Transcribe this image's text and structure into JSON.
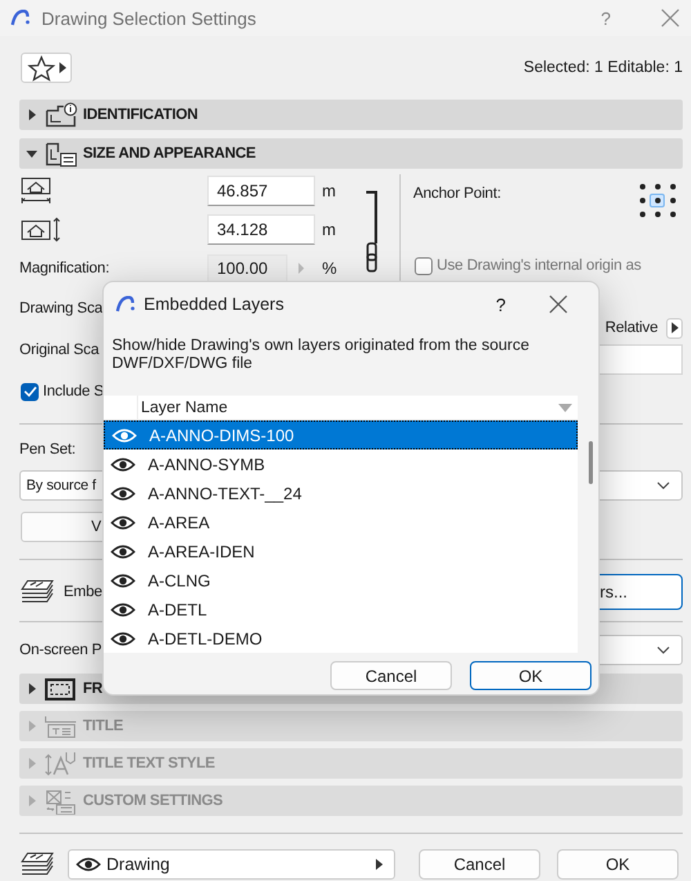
{
  "window": {
    "title": "Drawing Selection Settings",
    "help": "?"
  },
  "selection_info": "Selected: 1 Editable: 1",
  "top_sections": [
    {
      "title": "IDENTIFICATION",
      "expanded": false,
      "disabled": false
    },
    {
      "title": "SIZE AND APPEARANCE",
      "expanded": true,
      "disabled": false
    }
  ],
  "size_and_appearance": {
    "width": {
      "value": "46.857",
      "unit": "m"
    },
    "height": {
      "value": "34.128",
      "unit": "m"
    },
    "magnification": {
      "label": "Magnification:",
      "value": "100.00",
      "unit": "%"
    },
    "drawing_scale": {
      "label": "Drawing Sca"
    },
    "original_scale": {
      "label": "Original Sca"
    },
    "include": {
      "label": "Include S",
      "checked": true
    },
    "anchor": {
      "label": "Anchor Point:",
      "points": [
        {
          "selected": false
        },
        {
          "selected": false
        },
        {
          "selected": false
        },
        {
          "selected": false
        },
        {
          "selected": true
        },
        {
          "selected": false
        },
        {
          "selected": false
        },
        {
          "selected": false
        },
        {
          "selected": false
        }
      ]
    },
    "internal_origin": {
      "label": "Use Drawing's internal origin as",
      "checked": false
    },
    "relative": {
      "label": "Relative"
    },
    "pen_set": {
      "label": "Pen Set:",
      "value": "By source f"
    },
    "button_v": {
      "label": "V"
    },
    "embedded": {
      "label": "Embe",
      "button": "rs..."
    },
    "on_screen": {
      "label": "On-screen P"
    }
  },
  "bottom_sections": [
    {
      "title": "FR",
      "expanded": false,
      "disabled": false
    },
    {
      "title": "TITLE",
      "expanded": false,
      "disabled": true
    },
    {
      "title": "TITLE TEXT STYLE",
      "expanded": false,
      "disabled": true
    },
    {
      "title": "CUSTOM SETTINGS",
      "expanded": false,
      "disabled": true
    }
  ],
  "footer": {
    "layer": "Drawing",
    "cancel": "Cancel",
    "ok": "OK"
  },
  "embedded_layers": {
    "title": "Embedded Layers",
    "help": "?",
    "description": "Show/hide Drawing's own layers originated from the source DWF/DXF/DWG file",
    "column": "Layer Name",
    "layers": [
      {
        "name": "A-ANNO-DIMS-100",
        "visible": true,
        "selected": true
      },
      {
        "name": "A-ANNO-SYMB",
        "visible": true,
        "selected": false
      },
      {
        "name": "A-ANNO-TEXT-__24",
        "visible": true,
        "selected": false
      },
      {
        "name": "A-AREA",
        "visible": true,
        "selected": false
      },
      {
        "name": "A-AREA-IDEN",
        "visible": true,
        "selected": false
      },
      {
        "name": "A-CLNG",
        "visible": true,
        "selected": false
      },
      {
        "name": "A-DETL",
        "visible": true,
        "selected": false
      },
      {
        "name": "A-DETL-DEMO",
        "visible": true,
        "selected": false
      }
    ],
    "cancel": "Cancel",
    "ok": "OK"
  }
}
